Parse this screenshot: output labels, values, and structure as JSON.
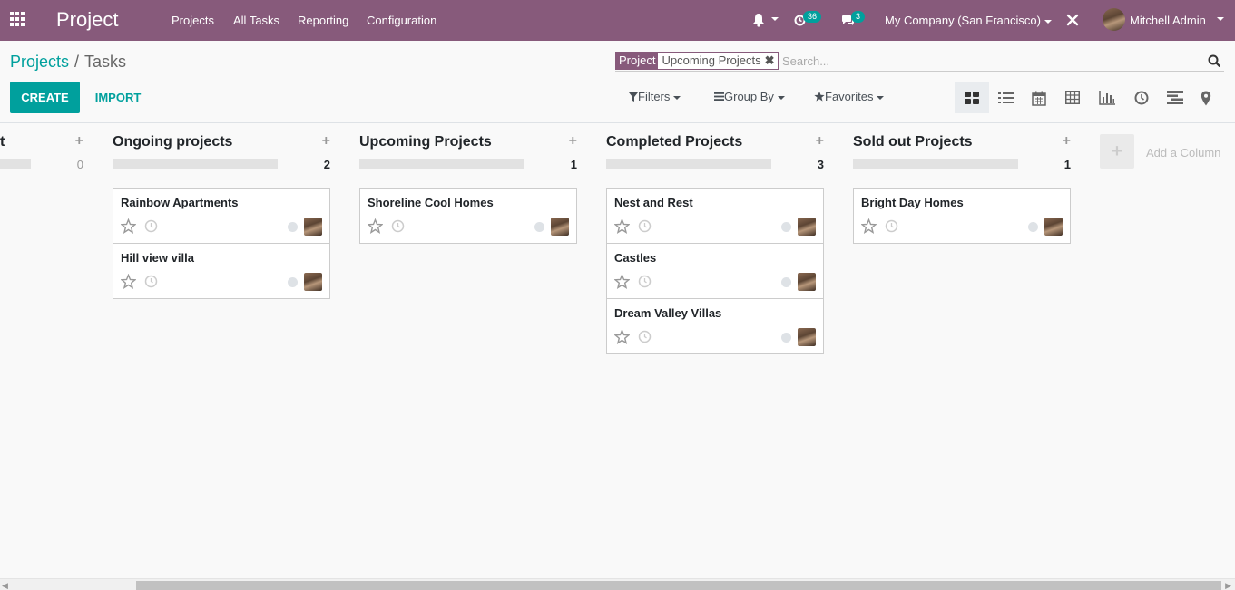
{
  "navbar": {
    "app_title": "Project",
    "menu": [
      "Projects",
      "All Tasks",
      "Reporting",
      "Configuration"
    ],
    "activity_badge": "36",
    "messages_badge": "3",
    "company": "My Company (San Francisco)",
    "user": "Mitchell Admin"
  },
  "breadcrumb": {
    "parent": "Projects",
    "separator": "/",
    "current": "Tasks"
  },
  "search": {
    "facet_label": "Project",
    "facet_value": "Upcoming Projects",
    "facet_remove": "✖",
    "placeholder": "Search..."
  },
  "buttons": {
    "create": "CREATE",
    "import": "IMPORT"
  },
  "filters": {
    "filters": "Filters",
    "group_by": "Group By",
    "favorites": "Favorites"
  },
  "views": [
    "kanban-icon",
    "list-icon",
    "calendar-icon",
    "pivot-icon",
    "graph-icon",
    "activity-icon",
    "gantt-icon",
    "map-icon"
  ],
  "kanban": {
    "partial_column": {
      "title_fragment": "t",
      "count": "0"
    },
    "columns": [
      {
        "title": "Ongoing projects",
        "count": "2",
        "cards": [
          "Rainbow Apartments",
          "Hill view villa"
        ]
      },
      {
        "title": "Upcoming Projects",
        "count": "1",
        "cards": [
          "Shoreline Cool Homes"
        ]
      },
      {
        "title": "Completed Projects",
        "count": "3",
        "cards": [
          "Nest and Rest",
          "Castles",
          "Dream Valley Villas"
        ]
      },
      {
        "title": "Sold out Projects",
        "count": "1",
        "cards": [
          "Bright Day Homes"
        ]
      }
    ],
    "add_column": "Add a Column",
    "add_column_plus": "+"
  },
  "colors": {
    "brand": "#875a7b",
    "accent": "#00a09d"
  }
}
